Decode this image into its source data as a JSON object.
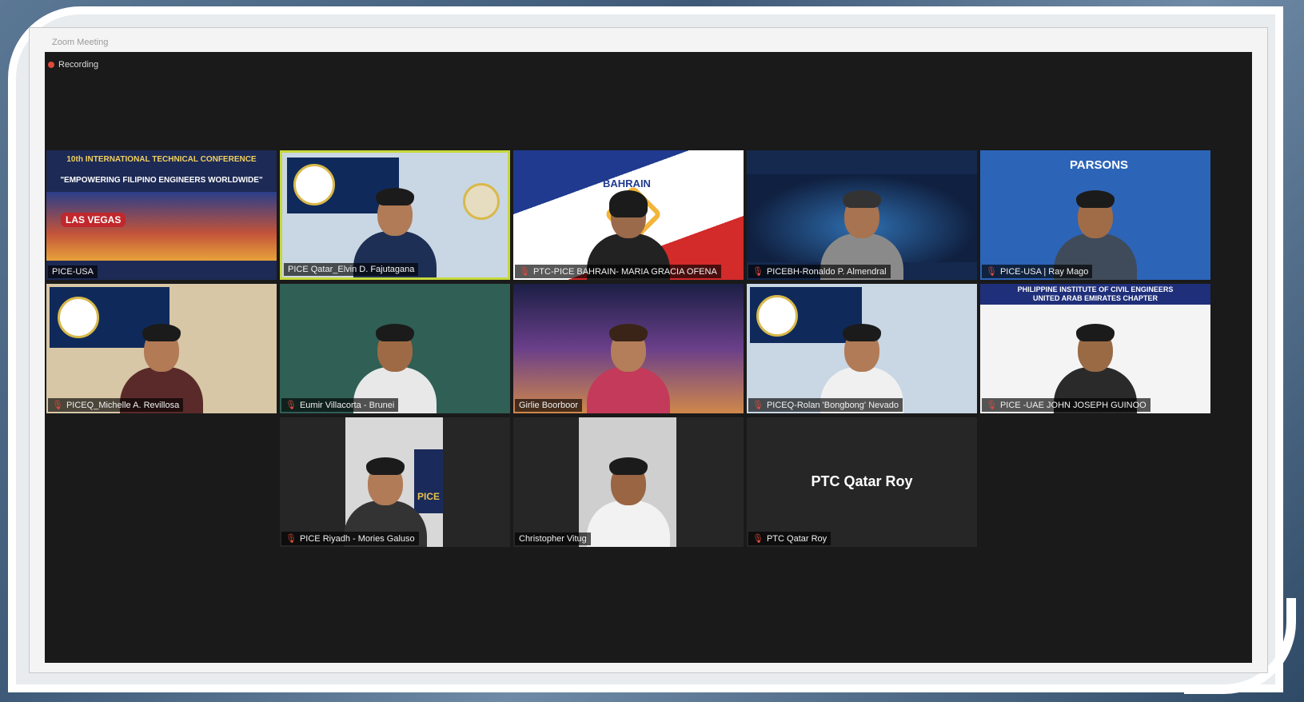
{
  "window": {
    "title": "Zoom Meeting"
  },
  "recording": {
    "label": "Recording"
  },
  "participants": [
    {
      "name": "PICE-USA",
      "mic_off": false
    },
    {
      "name": "PICE Qatar_Elvin D. Fajutagana",
      "mic_off": false,
      "active": true
    },
    {
      "name": "PTC-PICE BAHRAIN- MARIA GRACIA OFENA",
      "mic_off": true
    },
    {
      "name": "PICEBH-Ronaldo P. Almendral",
      "mic_off": true
    },
    {
      "name": "PICE-USA | Ray Mago",
      "mic_off": true
    },
    {
      "name": "PICEQ_Michelle A. Revillosa",
      "mic_off": true
    },
    {
      "name": "Eumir Villacorta - Brunei",
      "mic_off": true
    },
    {
      "name": "Girlie Boorboor",
      "mic_off": false
    },
    {
      "name": "PICEQ-Rolan 'Bongbong' Nevado",
      "mic_off": true
    },
    {
      "name": "PICE -UAE JOHN JOSEPH GUINOO",
      "mic_off": true
    },
    {
      "name": "PICE Riyadh - Mories Galuso",
      "mic_off": true
    },
    {
      "name": "Christopher Vitug",
      "mic_off": false
    },
    {
      "name": "PTC Qatar Roy",
      "mic_off": true,
      "video_off": true
    }
  ],
  "tile_text": {
    "usa_conf": "10th INTERNATIONAL TECHNICAL CONFERENCE",
    "usa_tagline": "\"EMPOWERING FILIPINO ENGINEERS WORLDWIDE\"",
    "las_vegas": "LAS VEGAS",
    "bahrain": "BAHRAIN",
    "parsons": "PARSONS",
    "uae_line1": "PHILIPPINE INSTITUTE OF CIVIL ENGINEERS",
    "uae_line2": "UNITED ARAB EMIRATES CHAPTER",
    "pice_sign": "PICE",
    "roy_center": "PTC Qatar Roy"
  },
  "colors": {
    "active_border": "#c6d83a",
    "mic_muted": "#e04a3a",
    "meeting_bg": "#1a1a1a"
  }
}
